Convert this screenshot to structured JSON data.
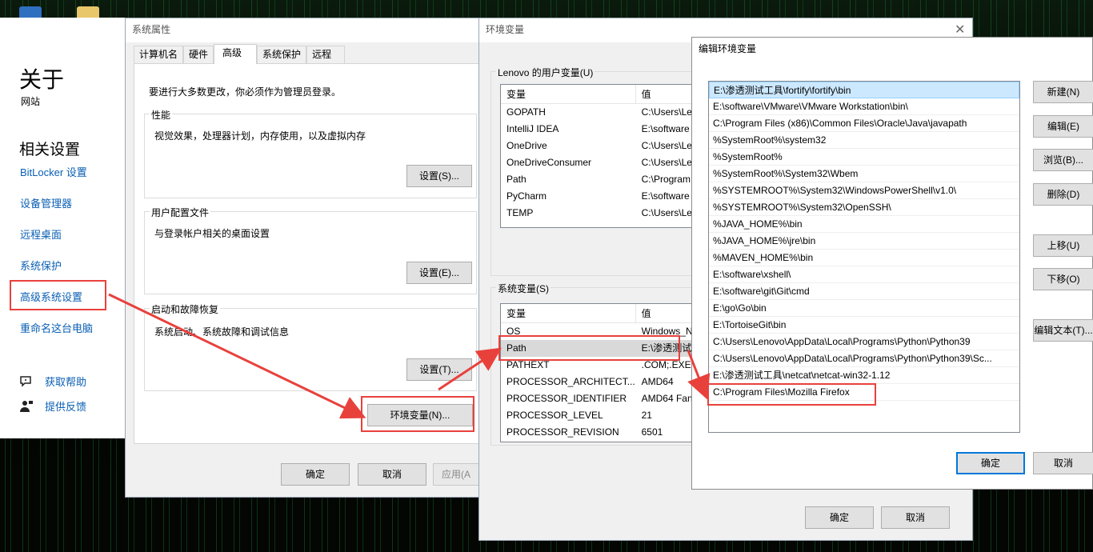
{
  "desktop": {
    "icon_colors": [
      "#2f6fc0",
      "#e8c66a"
    ]
  },
  "about_panel": {
    "title": "关于",
    "subtitle": "网站",
    "related_heading": "相关设置",
    "links": [
      "BitLocker 设置",
      "设备管理器",
      "远程桌面",
      "系统保护",
      "高级系统设置",
      "重命名这台电脑"
    ],
    "help": [
      {
        "icon": "help-chat-icon",
        "label": "获取帮助"
      },
      {
        "icon": "feedback-person-icon",
        "label": "提供反馈"
      }
    ]
  },
  "sys_props": {
    "title": "系统属性",
    "tabs": [
      "计算机名",
      "硬件",
      "高级",
      "系统保护",
      "远程"
    ],
    "active_tab": "高级",
    "admin_notice": "要进行大多数更改，你必须作为管理员登录。",
    "performance": {
      "label": "性能",
      "desc": "视觉效果，处理器计划，内存使用，以及虚拟内存",
      "button": "设置(S)..."
    },
    "user_profiles": {
      "label": "用户配置文件",
      "desc": "与登录帐户相关的桌面设置",
      "button": "设置(E)..."
    },
    "startup": {
      "label": "启动和故障恢复",
      "desc": "系统启动、系统故障和调试信息",
      "button": "设置(T)..."
    },
    "env_button": "环境变量(N)...",
    "ok": "确定",
    "cancel": "取消",
    "apply": "应用(A"
  },
  "env_vars": {
    "title": "环境变量",
    "close_icon": "close-icon",
    "user_section": "Lenovo 的用户变量(U)",
    "system_section": "系统变量(S)",
    "col_var": "变量",
    "col_val": "值",
    "user_vars": [
      {
        "name": "GOPATH",
        "value": "C:\\Users\\Le"
      },
      {
        "name": "IntelliJ IDEA",
        "value": "E:\\software"
      },
      {
        "name": "OneDrive",
        "value": "C:\\Users\\Le"
      },
      {
        "name": "OneDriveConsumer",
        "value": "C:\\Users\\Le"
      },
      {
        "name": "Path",
        "value": "C:\\Program"
      },
      {
        "name": "PyCharm",
        "value": "E:\\software"
      },
      {
        "name": "TEMP",
        "value": "C:\\Users\\Le"
      }
    ],
    "system_vars": [
      {
        "name": "OS",
        "value": "Windows_N"
      },
      {
        "name": "Path",
        "value": "E:\\渗透测试"
      },
      {
        "name": "PATHEXT",
        "value": ".COM;.EXE;"
      },
      {
        "name": "PROCESSOR_ARCHITECT...",
        "value": "AMD64"
      },
      {
        "name": "PROCESSOR_IDENTIFIER",
        "value": "AMD64 Fan"
      },
      {
        "name": "PROCESSOR_LEVEL",
        "value": "21"
      },
      {
        "name": "PROCESSOR_REVISION",
        "value": "6501"
      }
    ],
    "ok": "确定",
    "cancel": "取消"
  },
  "edit_env": {
    "title": "编辑环境变量",
    "paths": [
      "E:\\渗透测试工具\\fortify\\fortify\\bin",
      "E:\\software\\VMware\\VMware Workstation\\bin\\",
      "C:\\Program Files (x86)\\Common Files\\Oracle\\Java\\javapath",
      "%SystemRoot%\\system32",
      "%SystemRoot%",
      "%SystemRoot%\\System32\\Wbem",
      "%SYSTEMROOT%\\System32\\WindowsPowerShell\\v1.0\\",
      "%SYSTEMROOT%\\System32\\OpenSSH\\",
      "%JAVA_HOME%\\bin",
      "%JAVA_HOME%\\jre\\bin",
      "%MAVEN_HOME%\\bin",
      "E:\\software\\xshell\\",
      "E:\\software\\git\\Git\\cmd",
      "E:\\go\\Go\\bin",
      "E:\\TortoiseGit\\bin",
      "C:\\Users\\Lenovo\\AppData\\Local\\Programs\\Python\\Python39",
      "C:\\Users\\Lenovo\\AppData\\Local\\Programs\\Python\\Python39\\Sc...",
      "E:\\渗透测试工具\\netcat\\netcat-win32-1.12",
      "C:\\Program Files\\Mozilla Firefox"
    ],
    "buttons": [
      "新建(N)",
      "编辑(E)",
      "浏览(B)...",
      "删除(D)",
      "上移(U)",
      "下移(O)",
      "编辑文本(T)..."
    ],
    "ok": "确定",
    "cancel": "取消"
  },
  "annotation_color": "#e8413c"
}
